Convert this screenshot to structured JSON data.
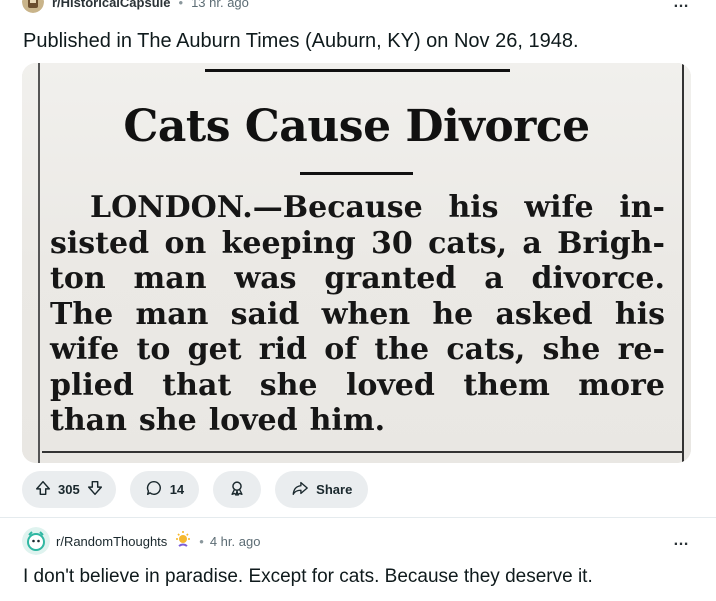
{
  "post": {
    "subreddit": "r/HistoricalCapsule",
    "age": "13 hr. ago",
    "title": "Published in The Auburn Times (Auburn, KY) on Nov 26, 1948.",
    "clipping": {
      "headline": "Cats Cause Divorce",
      "lines": [
        [
          "LONDON.—Because",
          "his",
          "wife",
          "in-"
        ],
        [
          "sisted",
          "on",
          "keeping",
          "30",
          "cats,",
          "a",
          "Brigh-"
        ],
        [
          "ton",
          "man",
          "was",
          "granted",
          "a",
          "divorce."
        ],
        [
          "The",
          "man",
          "said",
          "when",
          "he",
          "asked",
          "his"
        ],
        [
          "wife",
          "to",
          "get",
          "rid",
          "of",
          "the",
          "cats,",
          "she",
          "re-"
        ],
        [
          "plied",
          "that",
          "she",
          "loved",
          "them",
          "more"
        ],
        [
          "than",
          "she",
          "loved",
          "him."
        ]
      ]
    },
    "actions": {
      "votes": "305",
      "comments": "14",
      "share_label": "Share"
    }
  },
  "post2": {
    "subreddit": "r/RandomThoughts",
    "age": "4 hr. ago",
    "title": "I don't believe in paradise. Except for cats. Because they deserve it."
  },
  "icons": {
    "more": "more-options-icon",
    "upvote": "upvote-icon",
    "downvote": "downvote-icon",
    "comment": "comment-icon",
    "award": "award-icon",
    "share": "share-icon",
    "flair": "sun-award-icon"
  },
  "colors": {
    "pill_bg": "#eaedef",
    "text": "#0f1a1c",
    "meta": "#5c6c74"
  }
}
